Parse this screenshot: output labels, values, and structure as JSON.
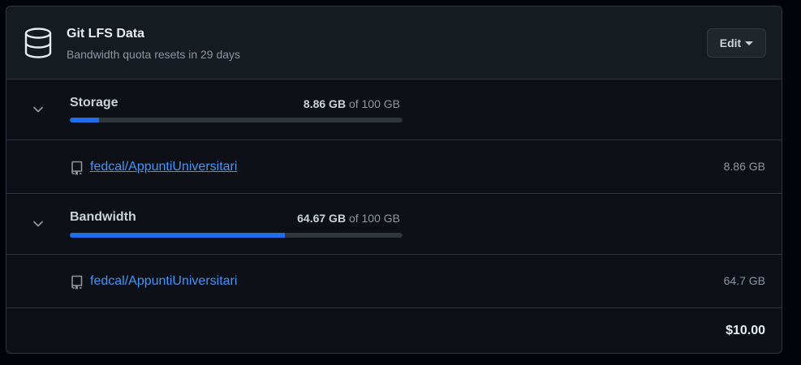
{
  "header": {
    "title": "Git LFS Data",
    "subtitle": "Bandwidth quota resets in 29 days",
    "edit_label": "Edit"
  },
  "storage": {
    "title": "Storage",
    "used": "8.86 GB",
    "of_label": "of 100 GB",
    "fraction_used": 0.0886,
    "repos": [
      {
        "name": "fedcal/AppuntiUniversitari",
        "size": "8.86 GB"
      }
    ]
  },
  "bandwidth": {
    "title": "Bandwidth",
    "used": "64.67 GB",
    "of_label": "of 100 GB",
    "fraction_used": 0.6467,
    "repos": [
      {
        "name": "fedcal/AppuntiUniversitari",
        "size": "64.7 GB"
      }
    ]
  },
  "total": "$10.00",
  "icons": {
    "database": "database-icon",
    "chevron": "chevron-down-icon",
    "repo": "repo-icon",
    "edit_caret": "triangle-down-icon"
  },
  "colors": {
    "accent": "#1f6feb",
    "link": "#4493f8",
    "background": "#0d1117",
    "header_background": "#161b22",
    "border": "#30363d"
  }
}
